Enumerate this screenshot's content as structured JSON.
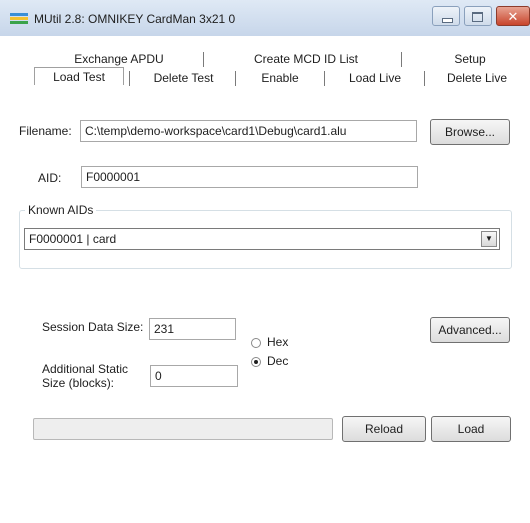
{
  "window": {
    "title": "MUtil 2.8: OMNIKEY CardMan 3x21 0",
    "icons": {
      "app": "mutil-app-icon",
      "minimize": "minimize-icon",
      "maximize": "maximize-icon",
      "close": "close-icon"
    },
    "close_glyph": "✕"
  },
  "tabs": {
    "row1": [
      "Exchange APDU",
      "Create MCD ID List",
      "Setup"
    ],
    "row2": [
      "Load Test",
      "Delete Test",
      "Enable",
      "Load Live",
      "Delete Live"
    ],
    "active": "Load Test"
  },
  "form": {
    "filename_label": "Filename:",
    "filename_value": "C:\\temp\\demo-workspace\\card1\\Debug\\card1.alu",
    "browse_label": "Browse...",
    "aid_label": "AID:",
    "aid_value": "F0000001",
    "known_aids_label": "Known AIDs",
    "known_aids_selected": "F0000001 | card",
    "dropdown_glyph": "▼",
    "session_label": "Session Data Size:",
    "session_value": "231",
    "static_label_line1": "Additional Static",
    "static_label_line2": "Size (blocks):",
    "static_value": "0",
    "hex_label": "Hex",
    "dec_label": "Dec",
    "selected_radix": "Dec",
    "advanced_label": "Advanced...",
    "reload_label": "Reload",
    "load_label": "Load",
    "progress_fraction": 0
  },
  "colors": {
    "titlebar": "#c7d6ea",
    "close": "#c8452c",
    "icon_top": "#3a8fd6",
    "icon_mid": "#f2c230",
    "icon_bot": "#3aa34a"
  }
}
